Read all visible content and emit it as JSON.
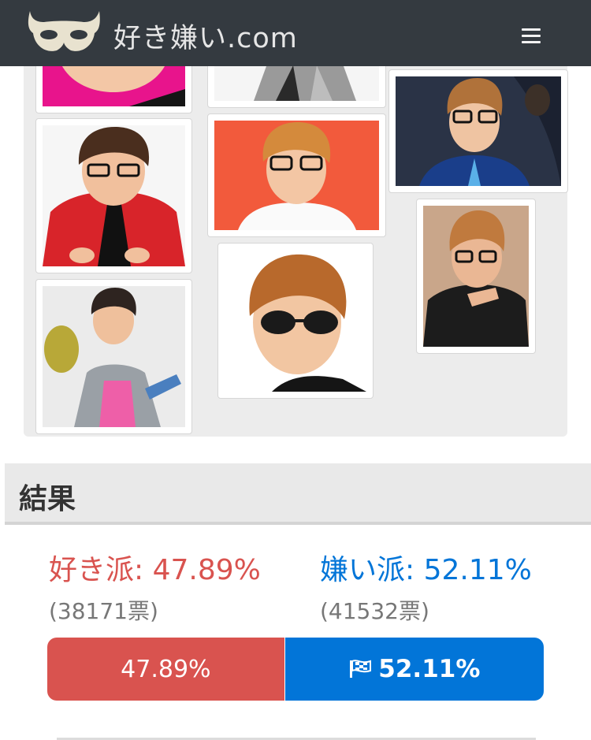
{
  "header": {
    "logo_text": "好き嫌い.com",
    "logo_icon": "mask-icon",
    "menu_icon": "hamburger-icon"
  },
  "gallery": {
    "photos": [
      {
        "name": "photo-pink-background",
        "bg": "#e8148c"
      },
      {
        "name": "photo-checkered-jacket",
        "bg": "#f2f2f2"
      },
      {
        "name": "photo-red-jacket",
        "bg": "#f6f6f6"
      },
      {
        "name": "photo-red-background",
        "bg": "#f25a3c"
      },
      {
        "name": "photo-dark-blue-background",
        "bg": "#2a3346"
      },
      {
        "name": "photo-durian",
        "bg": "#ebebeb"
      },
      {
        "name": "photo-sunglasses",
        "bg": "#ffffff"
      },
      {
        "name": "photo-thinking-pose",
        "bg": "#c9a68a"
      }
    ]
  },
  "result": {
    "title": "結果",
    "like_label": "好き派: 47.89%",
    "hate_label": "嫌い派: 52.11%",
    "like_votes": "(38171票)",
    "hate_votes": "(41532票)",
    "bar_like": "47.89%",
    "bar_hate": "52.11%",
    "like_share": 47.89,
    "hate_share": 52.11,
    "winner_icon": "checkered-flag-icon"
  },
  "colors": {
    "like": "#d9534f",
    "hate": "#0275d8",
    "header": "#343a40"
  }
}
